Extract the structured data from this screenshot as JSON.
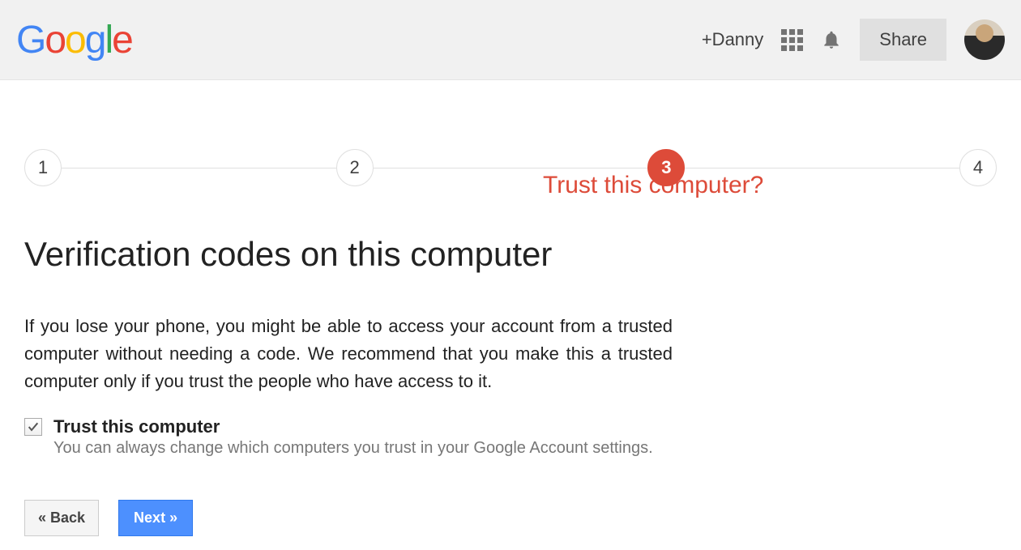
{
  "header": {
    "plus_name": "+Danny",
    "share_label": "Share"
  },
  "annotation": "Trust this computer?",
  "stepper": {
    "steps": [
      "1",
      "2",
      "3",
      "4"
    ],
    "active_index": 2
  },
  "main": {
    "heading": "Verification codes on this computer",
    "body": "If you lose your phone, you might be able to access your account from a trusted computer without needing a code. We recommend that you make this a trusted computer only if you trust the people who have access to it.",
    "checkbox": {
      "checked": true,
      "label": "Trust this computer",
      "sub": "You can always change which computers you trust in your Google Account settings."
    }
  },
  "actions": {
    "back": "« Back",
    "next": "Next »"
  }
}
